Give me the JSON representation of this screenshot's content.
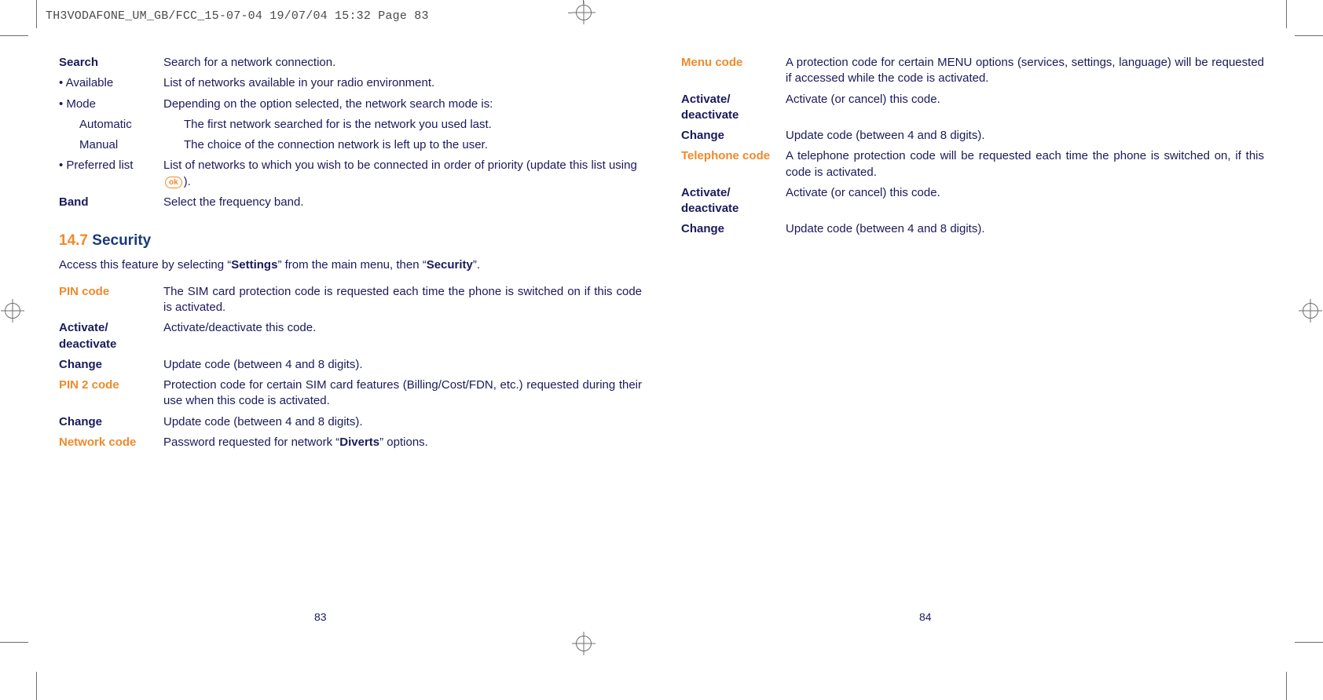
{
  "slug": "TH3VODAFONE_UM_GB/FCC_15-07-04  19/07/04  15:32  Page 83",
  "left_page_num": "83",
  "right_page_num": "84",
  "section": {
    "num": "14.7",
    "title": "Security"
  },
  "intro_pre": "Access this feature by selecting “",
  "intro_b1": "Settings",
  "intro_mid": "” from the main menu, then “",
  "intro_b2": "Security",
  "intro_post": "”.",
  "ok_label": "ok",
  "bullet_glyph": "• ",
  "l1": {
    "search_t": "Search",
    "search_d": "Search for a network connection.",
    "avail_t": "Available",
    "avail_d": "List of networks available in your radio environment.",
    "mode_t": "Mode",
    "mode_d": "Depending on the option selected, the network search mode is:",
    "auto_t": "Automatic",
    "auto_d": "The first network searched for is the network you used last.",
    "manual_t": "Manual",
    "manual_d": "The choice of the connection network is left up to the user.",
    "pref_t": "Preferred list",
    "pref_d_pre": "List of networks to which you wish to be connected in order of priority (update this list using ",
    "pref_d_post": ").",
    "band_t": "Band",
    "band_d": "Select the frequency band."
  },
  "l2": {
    "pin_t": "PIN code",
    "pin_d": "The SIM card protection code is requested each time the phone is switched on if this code is activated.",
    "act1_t": "Activate/ deactivate",
    "act1_d": "Activate/deactivate this code.",
    "chg1_t": "Change",
    "chg1_d": "Update code (between 4 and 8 digits).",
    "pin2_t": "PIN 2 code",
    "pin2_d": "Protection code for certain SIM card features (Billing/Cost/FDN, etc.) requested during their use when this code is activated.",
    "chg2_t": "Change",
    "chg2_d": "Update code (between 4 and 8 digits).",
    "net_t": "Network code",
    "net_d_pre": "Password requested for network “",
    "net_d_b": "Diverts",
    "net_d_post": "” options."
  },
  "r1": {
    "menu_t": "Menu code",
    "menu_d": "A protection code for certain MENU options (services, settings, language) will be requested if accessed while the code is activated.",
    "act1_t": "Activate/ deactivate",
    "act1_d": "Activate (or cancel) this code.",
    "chg1_t": "Change",
    "chg1_d": "Update code (between 4 and 8 digits).",
    "tel_t": "Telephone code",
    "tel_d": "A telephone protection code will be requested each time the phone is switched on, if this code is activated.",
    "act2_t": "Activate/ deactivate",
    "act2_d": "Activate (or cancel) this code.",
    "chg2_t": "Change",
    "chg2_d": "Update code (between 4 and 8 digits)."
  }
}
